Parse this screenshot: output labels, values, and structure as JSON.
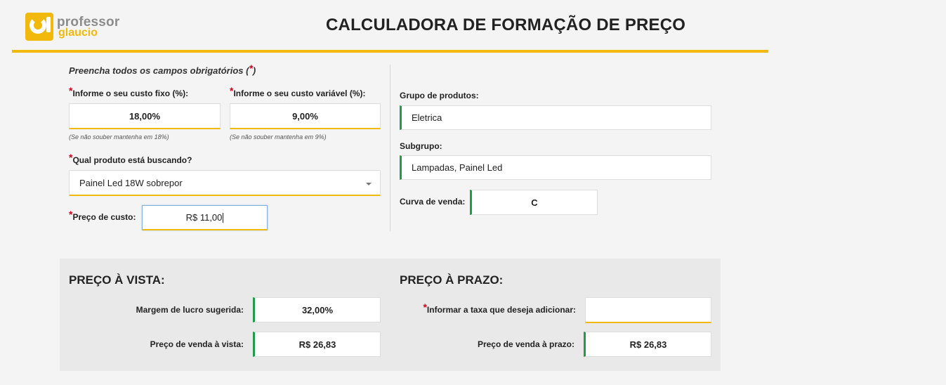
{
  "header": {
    "logo_line1": "professor",
    "logo_line2": "glaucio",
    "title": "CALCULADORA DE FORMAÇÃO DE PREÇO"
  },
  "form": {
    "instruction": "Preencha todos os campos obrigatórios (",
    "instruction_req": "*",
    "instruction_end": ")",
    "required_mark": "*",
    "fixed_cost": {
      "label": "Informe o seu custo fixo (%):",
      "value": "18,00%",
      "hint": "(Se não souber mantenha em 18%)"
    },
    "variable_cost": {
      "label": "Informe o seu custo variável (%):",
      "value": "9,00%",
      "hint": "(Se não souber mantenha em 9%)"
    },
    "product": {
      "label": "Qual produto está buscando?",
      "selected": "Painel Led 18W sobrepor"
    },
    "cost_price": {
      "label": "Preço de custo:",
      "value": "R$ 11,00"
    }
  },
  "info": {
    "group": {
      "label": "Grupo de produtos:",
      "value": "Eletrica"
    },
    "subgroup": {
      "label": "Subgrupo:",
      "value": "Lampadas, Painel Led"
    },
    "sales_curve": {
      "label": "Curva de venda:",
      "value": "C"
    }
  },
  "cash": {
    "title": "PREÇO À VISTA:",
    "margin_label": "Margem de lucro sugerida:",
    "margin_value": "32,00%",
    "price_label": "Preço de venda à vista:",
    "price_value": "R$ 26,83"
  },
  "term": {
    "title": "PREÇO À PRAZO:",
    "rate_label": "Informar a taxa que deseja adicionar:",
    "rate_value": "",
    "price_label": "Preço de venda à prazo:",
    "price_value": "R$ 26,83"
  },
  "colors": {
    "accent": "#f0b90b",
    "success": "#1e9c4a",
    "required": "#d0021b"
  }
}
